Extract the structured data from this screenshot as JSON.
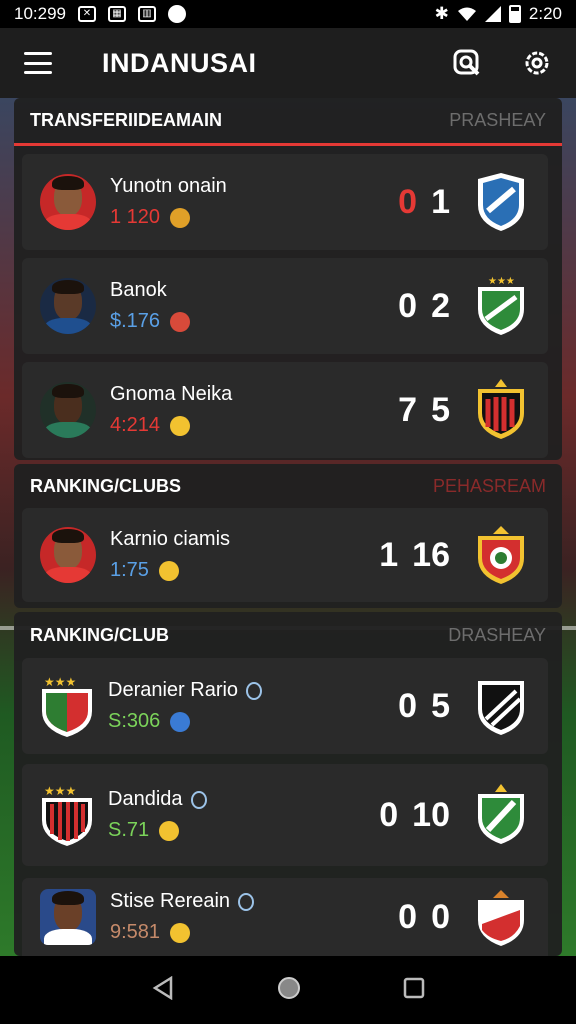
{
  "status_bar": {
    "time_left": "10:299",
    "time_right": "2:20"
  },
  "app_bar": {
    "title": "INDANUSAI"
  },
  "sections": [
    {
      "title": "TRANSFERIIDEAMAIN",
      "right_label": "PRASHEAY",
      "right_color": "#6d6d6d"
    },
    {
      "title": "RANKING/CLUBS",
      "right_label": "PEHASREAM",
      "right_color": "#8a2a2a"
    },
    {
      "title": "RANKING/CLUB",
      "right_label": "DRASHEAY",
      "right_color": "#6d6d6d"
    }
  ],
  "rows": [
    {
      "name": "Yunotn onain",
      "value": "1 120",
      "value_color": "#e53935",
      "score_a": "0",
      "score_b": "1",
      "score_a_color": "#e53935"
    },
    {
      "name": "Banok",
      "value": "$.176",
      "value_color": "#5aa0e6",
      "score_a": "0",
      "score_b": "2",
      "score_a_color": "#ffffff"
    },
    {
      "name": "Gnoma Neika",
      "value": "4:214",
      "value_color": "#e53935",
      "score_a": "7",
      "score_b": "5",
      "score_a_color": "#ffffff"
    },
    {
      "name": "Karnio ciamis",
      "value": "1:75",
      "value_color": "#5aa0e6",
      "score_a": "1",
      "score_b": "16",
      "score_a_color": "#ffffff"
    },
    {
      "name": "Deranier Rario",
      "value": "S:306",
      "value_color": "#7bd35a",
      "score_a": "0",
      "score_b": "5",
      "score_a_color": "#ffffff"
    },
    {
      "name": "Dandida",
      "value": "S.71",
      "value_color": "#7bd35a",
      "score_a": "0",
      "score_b": "10",
      "score_a_color": "#ffffff"
    },
    {
      "name": "Stise Rereain",
      "value": "9:581",
      "value_color": "#c58a6a",
      "score_a": "0",
      "score_b": "0",
      "score_a_color": "#ffffff"
    }
  ],
  "icons": {
    "menu": "menu-icon",
    "search": "search-icon",
    "settings": "settings-icon",
    "back": "back-icon",
    "home": "home-icon",
    "recents": "recents-icon"
  },
  "colors": {
    "accent": "#e53935",
    "panel": "#202020",
    "row": "#2a2a2a"
  }
}
